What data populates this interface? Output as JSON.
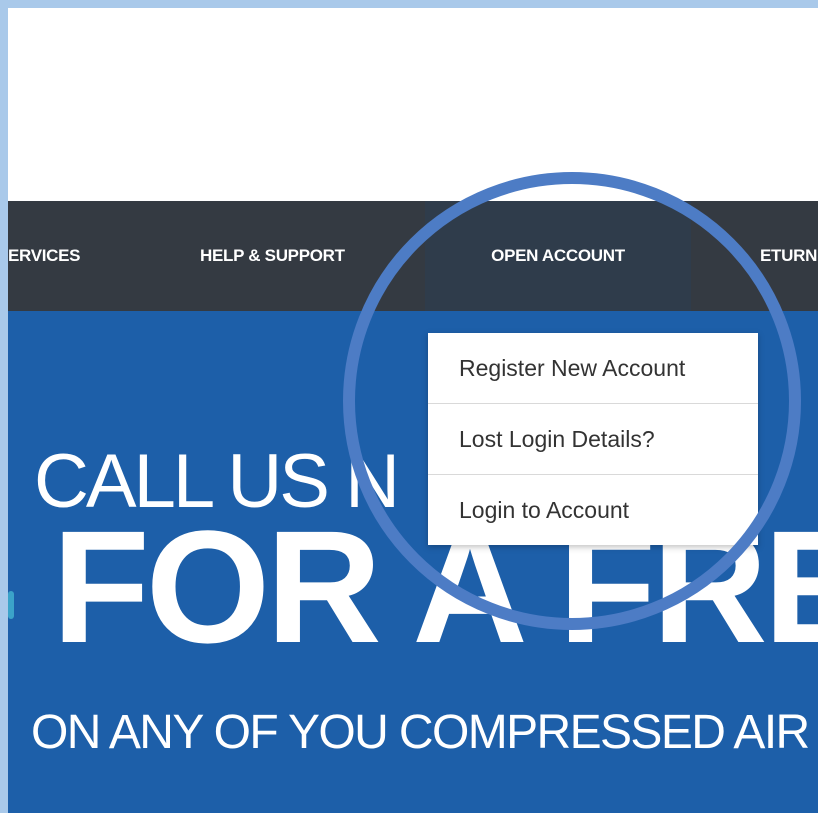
{
  "nav": {
    "items": [
      {
        "label": "ERVICES"
      },
      {
        "label": "HELP & SUPPORT"
      },
      {
        "label": "OPEN ACCOUNT"
      },
      {
        "label": "ETURN"
      }
    ]
  },
  "dropdown": {
    "items": [
      {
        "label": "Register New Account"
      },
      {
        "label": "Lost Login Details?"
      },
      {
        "label": "Login to Account"
      }
    ]
  },
  "hero": {
    "line1": "CALL US N",
    "line2": "FOR A FRE",
    "line3": "ON ANY OF YOU COMPRESSED AIR"
  },
  "colors": {
    "frame": "#a9c9ea",
    "navbar": "#343a42",
    "nav_active": "#2f3c4b",
    "hero": "#1d5fa9",
    "highlight": "#4d7cc5"
  }
}
